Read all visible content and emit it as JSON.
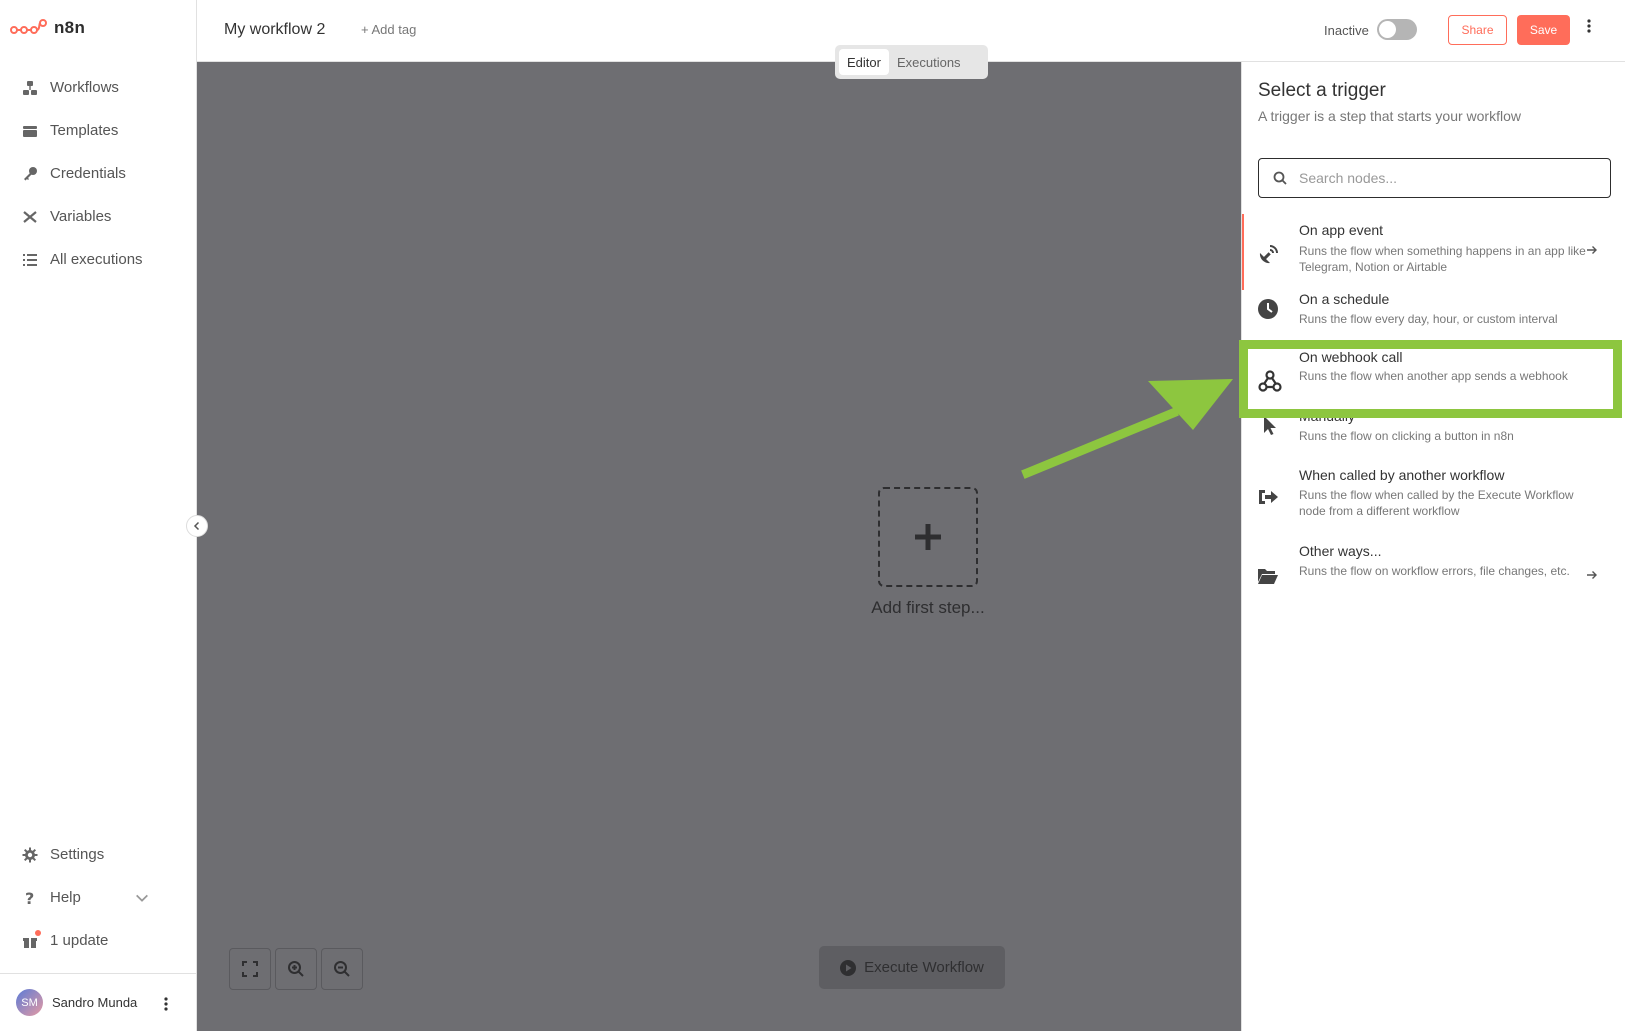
{
  "app": {
    "name": "n8n"
  },
  "sidebar": {
    "items": [
      {
        "label": "Workflows",
        "icon": "workflows-icon"
      },
      {
        "label": "Templates",
        "icon": "templates-icon"
      },
      {
        "label": "Credentials",
        "icon": "key-icon"
      },
      {
        "label": "Variables",
        "icon": "variables-icon"
      },
      {
        "label": "All executions",
        "icon": "list-icon"
      }
    ],
    "bottom": [
      {
        "label": "Settings",
        "icon": "gear-icon"
      },
      {
        "label": "Help",
        "icon": "question-icon"
      },
      {
        "label": "1 update",
        "icon": "gift-icon"
      }
    ],
    "user": {
      "initials": "SM",
      "name": "Sandro Munda"
    }
  },
  "header": {
    "workflow_name": "My workflow 2",
    "add_tag": "+ Add tag",
    "status": "Inactive",
    "share_label": "Share",
    "save_label": "Save"
  },
  "tabs": [
    {
      "label": "Editor",
      "active": true
    },
    {
      "label": "Executions",
      "active": false
    }
  ],
  "canvas": {
    "add_first_step": "Add first step...",
    "execute_label": "Execute Workflow"
  },
  "panel": {
    "title": "Select a trigger",
    "subtitle": "A trigger is a step that starts your workflow",
    "search_placeholder": "Search nodes...",
    "items": [
      {
        "title": "On app event",
        "desc": "Runs the flow when something happens in an app like Telegram, Notion or Airtable",
        "icon": "satellite-icon",
        "has_arrow": true
      },
      {
        "title": "On a schedule",
        "desc": "Runs the flow every day, hour, or custom interval",
        "icon": "clock-icon",
        "has_arrow": false
      },
      {
        "title": "On webhook call",
        "desc": "Runs the flow when another app sends a webhook",
        "icon": "webhook-icon",
        "has_arrow": false
      },
      {
        "title": "Manually",
        "desc": "Runs the flow on clicking a button in n8n",
        "icon": "cursor-icon",
        "has_arrow": false
      },
      {
        "title": "When called by another workflow",
        "desc": "Runs the flow when called by the Execute Workflow node from a different workflow",
        "icon": "sign-in-icon",
        "has_arrow": false
      },
      {
        "title": "Other ways...",
        "desc": "Runs the flow on workflow errors, file changes, etc.",
        "icon": "folder-open-icon",
        "has_arrow": true
      }
    ]
  },
  "colors": {
    "accent": "#ff6d5a",
    "highlight": "#8dc63f",
    "canvas": "#6e6e72"
  }
}
